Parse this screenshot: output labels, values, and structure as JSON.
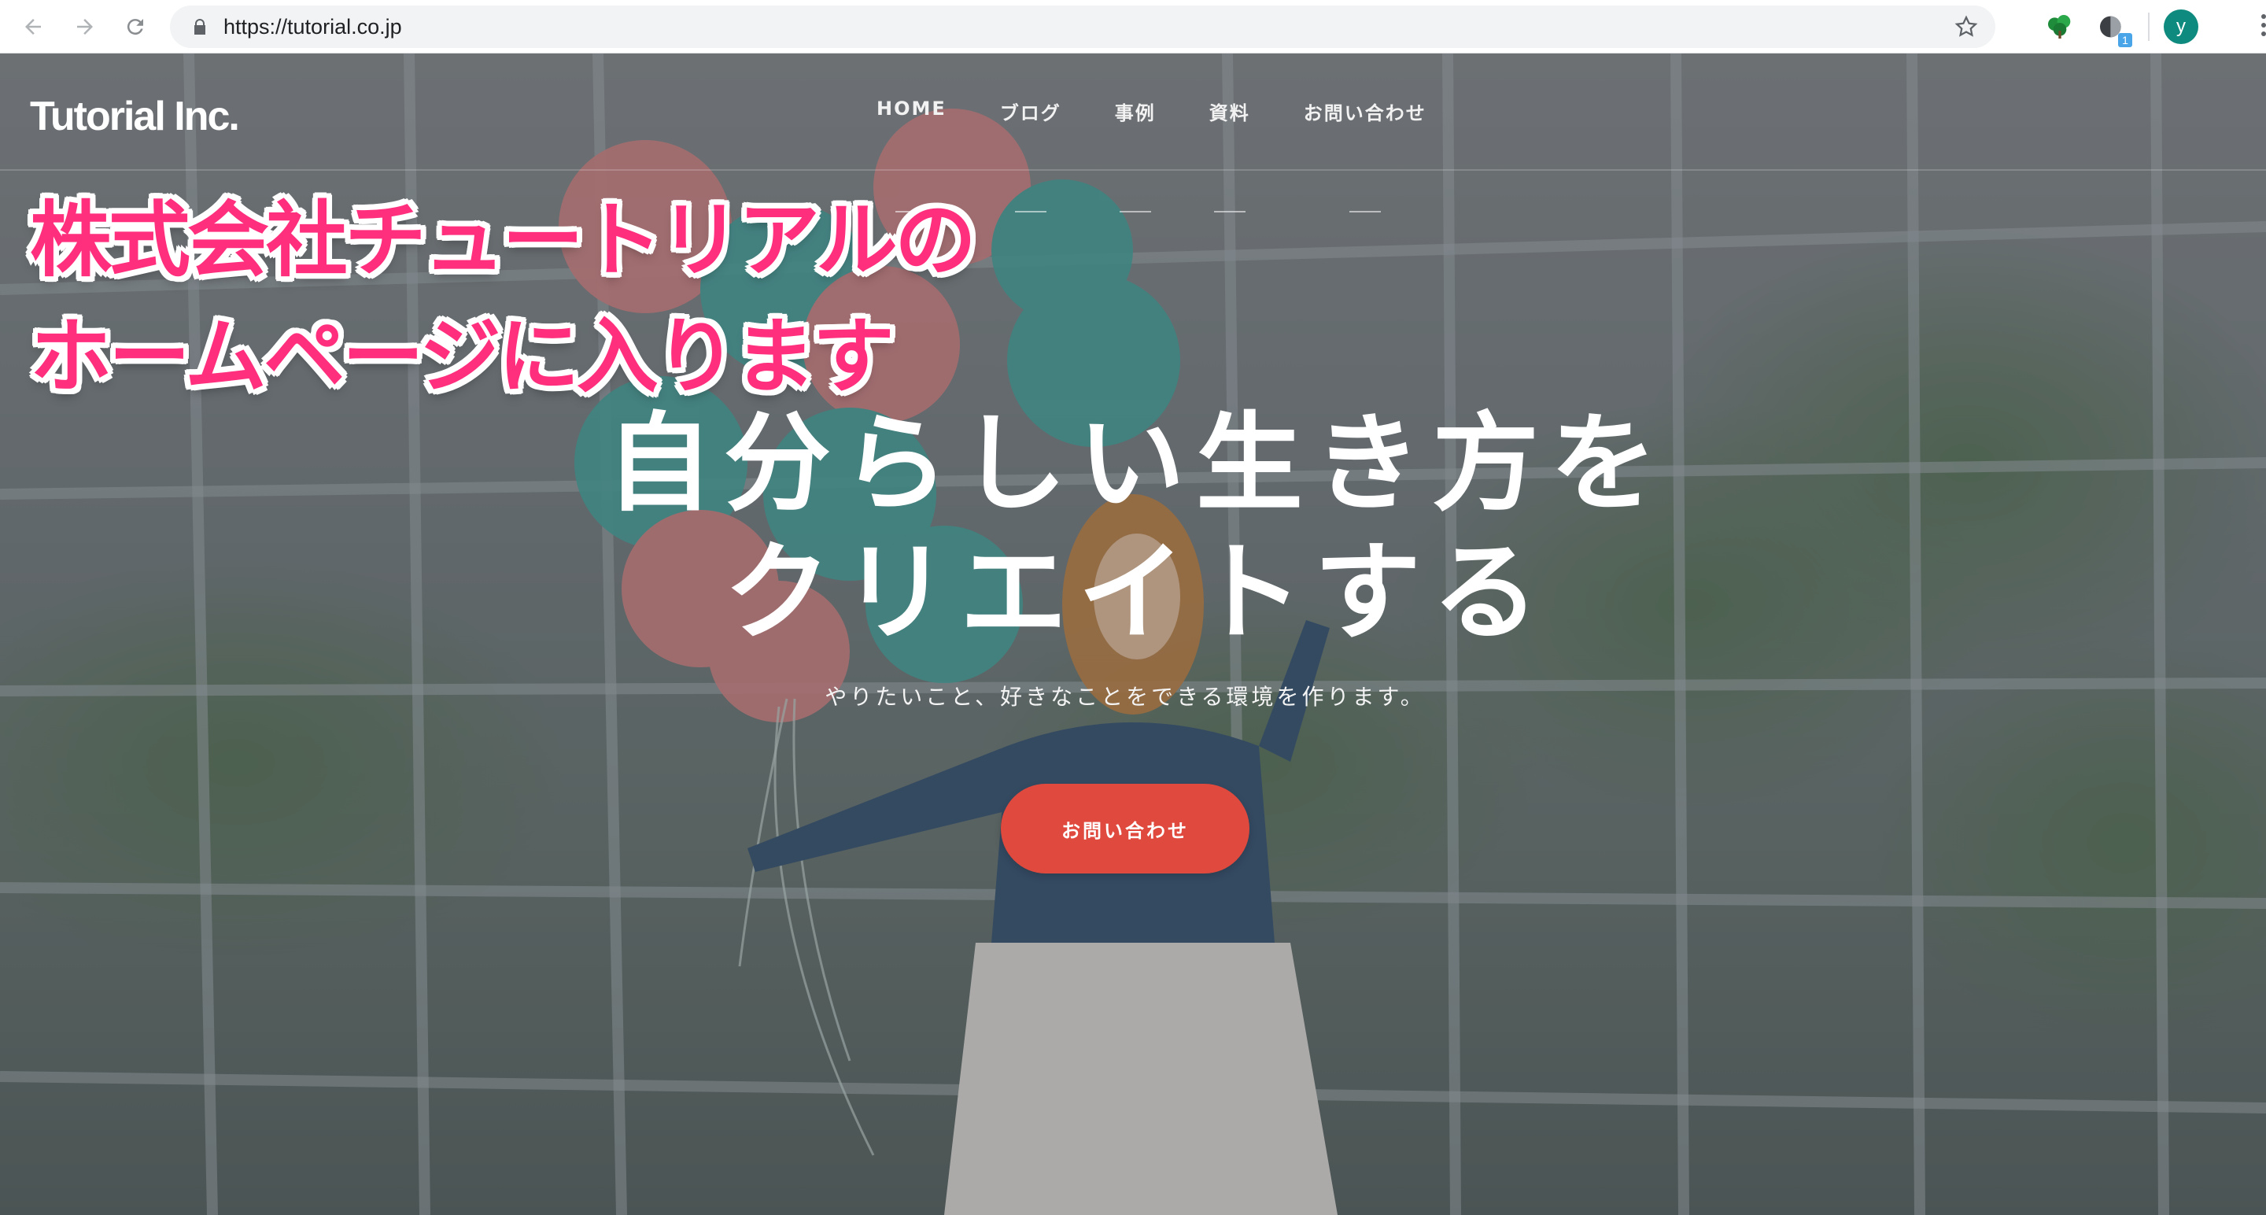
{
  "browser": {
    "url": "https://tutorial.co.jp",
    "profile_initial": "y",
    "extension_badge": "1",
    "icons": [
      "back-icon",
      "forward-icon",
      "reload-icon",
      "lock-icon",
      "star-icon",
      "tree-extension-icon",
      "extension-icon",
      "kebab-menu-icon"
    ]
  },
  "site": {
    "logo": "Tutorial Inc.",
    "nav": [
      {
        "label": "HOME"
      },
      {
        "label": "ブログ"
      },
      {
        "label": "事例"
      },
      {
        "label": "資料"
      },
      {
        "label": "お問い合わせ"
      }
    ]
  },
  "annotation": {
    "line1": "株式会社チュートリアルの",
    "line2": "ホームページに入ります",
    "color": "#ff2f7e"
  },
  "hero": {
    "headline_line1": "自分らしい生き方を",
    "headline_line2": "クリエイトする",
    "subline": "やりたいこと、好きなことをできる環境を作ります。",
    "cta_label": "お問い合わせ",
    "cta_color": "#e0493d"
  }
}
